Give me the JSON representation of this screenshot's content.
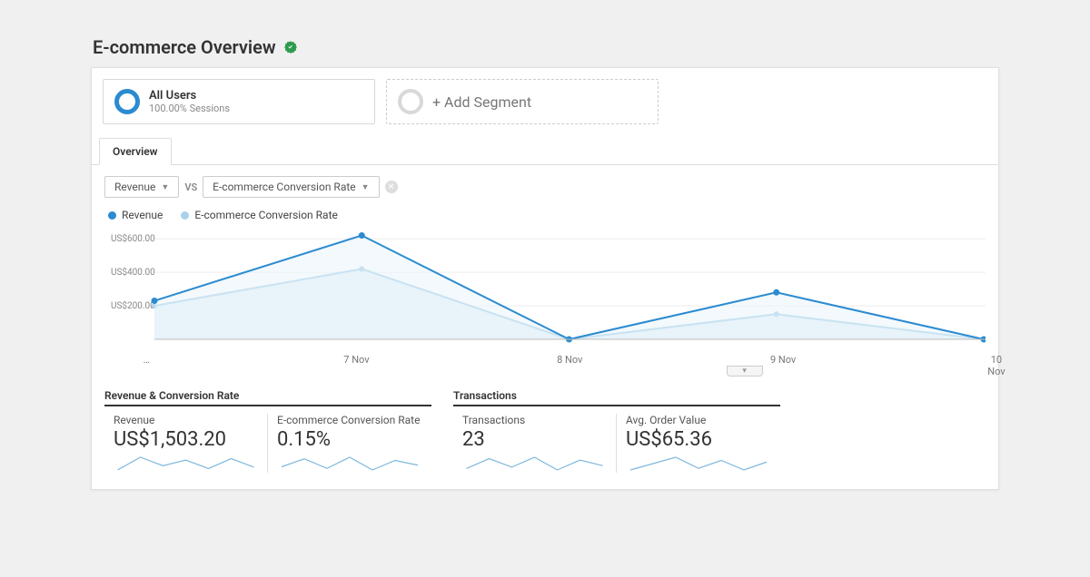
{
  "header": {
    "title": "E-commerce Overview"
  },
  "segments": {
    "primary": {
      "title": "All Users",
      "subtitle": "100.00% Sessions"
    },
    "add_label": "+ Add Segment"
  },
  "tabs": {
    "overview": "Overview"
  },
  "selectors": {
    "metric_a": "Revenue",
    "vs": "VS",
    "metric_b": "E-commerce Conversion Rate"
  },
  "legend": {
    "a": "Revenue",
    "b": "E-commerce Conversion Rate"
  },
  "groups": {
    "rev_conv": {
      "header": "Revenue & Conversion Rate",
      "revenue": {
        "label": "Revenue",
        "value": "US$1,503.20"
      },
      "conv_rate": {
        "label": "E-commerce Conversion Rate",
        "value": "0.15%"
      }
    },
    "transactions": {
      "header": "Transactions",
      "count": {
        "label": "Transactions",
        "value": "23"
      },
      "aov": {
        "label": "Avg. Order Value",
        "value": "US$65.36"
      }
    }
  },
  "chart_data": {
    "type": "line",
    "x": [
      "…",
      "7 Nov",
      "8 Nov",
      "9 Nov",
      "10 Nov"
    ],
    "series": [
      {
        "name": "Revenue",
        "values": [
          230,
          620,
          0,
          280,
          0
        ]
      },
      {
        "name": "E-commerce Conversion Rate",
        "values": [
          200,
          420,
          0,
          150,
          0
        ]
      }
    ],
    "ylabel": "",
    "yticks": [
      "US$200.00",
      "US$400.00",
      "US$600.00"
    ],
    "ylim": [
      0,
      650
    ]
  },
  "spark_data": {
    "revenue": [
      3,
      12,
      6,
      10,
      4,
      11,
      5
    ],
    "conv_rate": [
      5,
      10,
      4,
      11,
      3,
      9,
      6
    ],
    "tx_count": [
      4,
      11,
      5,
      12,
      3,
      10,
      6
    ],
    "aov": [
      4,
      8,
      12,
      5,
      10,
      4,
      9
    ]
  }
}
